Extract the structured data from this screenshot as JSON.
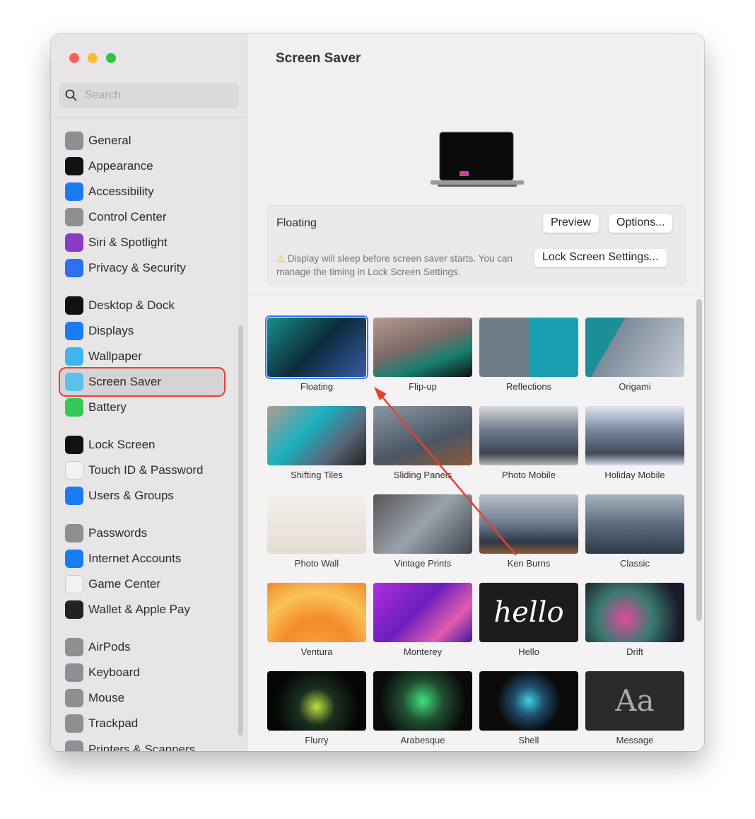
{
  "sidebar": {
    "search_placeholder": "Search",
    "items": [
      {
        "label": "General",
        "icon": "gear-icon",
        "color": "#8e8e93"
      },
      {
        "label": "Appearance",
        "icon": "appearance-icon",
        "color": "#111111"
      },
      {
        "label": "Accessibility",
        "icon": "accessibility-icon",
        "color": "#1a7cf5"
      },
      {
        "label": "Control Center",
        "icon": "control-center-icon",
        "color": "#8e8e93"
      },
      {
        "label": "Siri & Spotlight",
        "icon": "siri-icon",
        "color": "#8a3cc8"
      },
      {
        "label": "Privacy & Security",
        "icon": "hand-icon",
        "color": "#2f6ff0"
      },
      {
        "label": "Desktop & Dock",
        "icon": "dock-icon",
        "color": "#111111"
      },
      {
        "label": "Displays",
        "icon": "sun-icon",
        "color": "#1a7cf5"
      },
      {
        "label": "Wallpaper",
        "icon": "wallpaper-icon",
        "color": "#40b4f0"
      },
      {
        "label": "Screen Saver",
        "icon": "screen-saver-icon",
        "color": "#5ac2e8",
        "selected": true
      },
      {
        "label": "Battery",
        "icon": "battery-icon",
        "color": "#34c759"
      },
      {
        "label": "Lock Screen",
        "icon": "lock-icon",
        "color": "#111111"
      },
      {
        "label": "Touch ID & Password",
        "icon": "fingerprint-icon",
        "color": "#f2f2f2"
      },
      {
        "label": "Users & Groups",
        "icon": "users-icon",
        "color": "#1a7cf5"
      },
      {
        "label": "Passwords",
        "icon": "key-icon",
        "color": "#8e8e93"
      },
      {
        "label": "Internet Accounts",
        "icon": "at-icon",
        "color": "#1a7cf5"
      },
      {
        "label": "Game Center",
        "icon": "game-center-icon",
        "color": "#f2f2f2"
      },
      {
        "label": "Wallet & Apple Pay",
        "icon": "wallet-icon",
        "color": "#222222"
      },
      {
        "label": "AirPods",
        "icon": "airpods-icon",
        "color": "#8e8e93"
      },
      {
        "label": "Keyboard",
        "icon": "keyboard-icon",
        "color": "#8e8e93"
      },
      {
        "label": "Mouse",
        "icon": "mouse-icon",
        "color": "#8e8e93"
      },
      {
        "label": "Trackpad",
        "icon": "trackpad-icon",
        "color": "#8e8e93"
      },
      {
        "label": "Printers & Scanners",
        "icon": "printer-icon",
        "color": "#8e8e93"
      }
    ]
  },
  "main": {
    "title": "Screen Saver",
    "selected_name": "Floating",
    "preview_label": "Preview",
    "options_label": "Options...",
    "warning_text": "Display will sleep before screen saver starts. You can manage the timing in Lock Screen Settings.",
    "lock_screen_button": "Lock Screen Settings...",
    "savers": [
      {
        "label": "Floating",
        "active": true,
        "bg": "linear-gradient(135deg,#1a8f8a,#0b2b3a 50%,#3a5aa8)"
      },
      {
        "label": "Flip-up",
        "bg": "linear-gradient(160deg,#b59b92,#7c6a66 45%,#17806f 70%,#111)"
      },
      {
        "label": "Reflections",
        "bg": "linear-gradient(90deg,#6d7d88 50%,#19a0b0 50%)"
      },
      {
        "label": "Origami",
        "bg": "linear-gradient(120deg,#1b8f95 30%,#7d8a9a 30%,#c4ccd4)"
      },
      {
        "label": "Shifting Tiles",
        "bg": "linear-gradient(135deg,#b59b92,#1ab0c0 40%,#58677a 70%,#222)"
      },
      {
        "label": "Sliding Panels",
        "bg": "linear-gradient(160deg,#8b97a8,#4b5664 60%,#8a5a3a)"
      },
      {
        "label": "Photo Mobile",
        "bg": "linear-gradient(180deg,#d9d9d9,#6f7e90 40%,#3c4551 80%,#b8b8b8)"
      },
      {
        "label": "Holiday Mobile",
        "bg": "linear-gradient(180deg,#dfe3ef,#7b8aa0 40%,#3f4a5a 80%,#d6dae6)"
      },
      {
        "label": "Photo Wall",
        "bg": "linear-gradient(180deg,#f3f0ec,#e4ddd4)"
      },
      {
        "label": "Vintage Prints",
        "bg": "linear-gradient(135deg,#555,#9aa3ac 50%,#3c444c)"
      },
      {
        "label": "Ken Burns",
        "bg": "linear-gradient(180deg,#b7c0cc,#6b7a8e 50%,#2e3846 80%,#8a5a3a)"
      },
      {
        "label": "Classic",
        "bg": "linear-gradient(180deg,#aab4c0,#5d6c80 50%,#2d3a48)"
      },
      {
        "label": "Ventura",
        "bg": "radial-gradient(circle at 50% 120%,#f7a640,#f58a2a 40%,#f9c25a 70%,#f08a2a)"
      },
      {
        "label": "Monterey",
        "bg": "linear-gradient(135deg,#b12fd8,#6a1fbf 45%,#e25cb0 75%,#3a1aa0)"
      },
      {
        "label": "Hello",
        "bg": "#1c1c1c",
        "text": "hello"
      },
      {
        "label": "Drift",
        "bg": "radial-gradient(circle at 40% 60%,#e04aa0,#3a7a70 40%,#1a1a2a 80%)"
      },
      {
        "label": "Flurry",
        "bg": "radial-gradient(circle at 50% 60%,#c0e040,#1a3020 30%,#050505 70%)"
      },
      {
        "label": "Arabesque",
        "bg": "radial-gradient(circle at 50% 50%,#40e080,#205030 35%,#0a0a0a 75%)"
      },
      {
        "label": "Shell",
        "bg": "radial-gradient(circle at 50% 50%,#40d0e0,#205070 25%,#0a0a0a 55%)"
      },
      {
        "label": "Message",
        "bg": "#2a2a2a",
        "text": "Aa"
      }
    ]
  },
  "colors": {
    "accent": "#2f7bf6",
    "highlight": "#e8402f",
    "close": "#fe5f57",
    "minimize": "#febc2e",
    "zoom": "#28c840"
  }
}
